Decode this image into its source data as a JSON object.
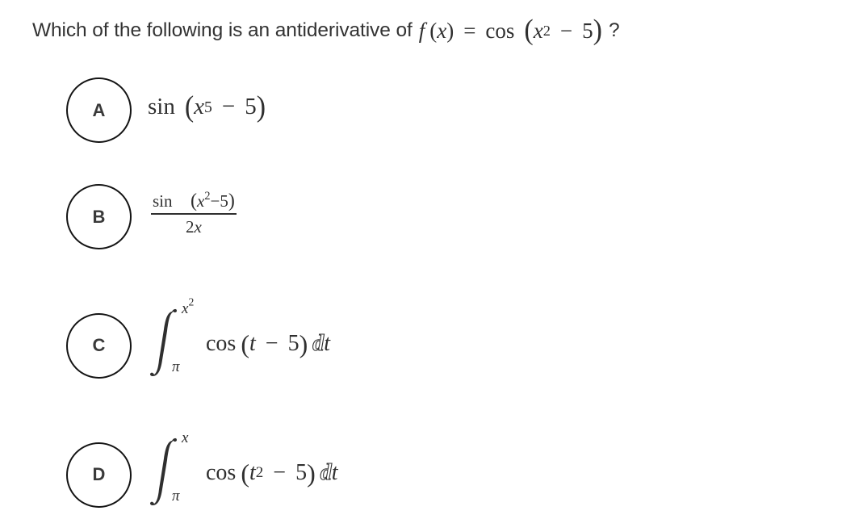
{
  "question": {
    "prefix": "Which of the following is an antiderivative of",
    "function_name": "f",
    "variable": "x",
    "equals": "=",
    "trig": "cos",
    "inner_var": "x",
    "inner_exp": "2",
    "minus": "−",
    "constant": "5",
    "open_paren": "(",
    "close_paren": ")",
    "suffix": "?"
  },
  "options": [
    {
      "label": "A",
      "latex": "\\sin\\left(x^5 - 5\\right)",
      "trig": "sin",
      "var": "x",
      "exp": "5",
      "minus": "−",
      "constant": "5",
      "open_paren": "(",
      "close_paren": ")"
    },
    {
      "label": "B",
      "latex": "\\frac{\\sin\\left(x^2-5\\right)}{2x}",
      "trig": "sin",
      "var": "x",
      "exp": "2",
      "minus": "−",
      "constant": "5",
      "open_paren": "(",
      "close_paren": ")",
      "den_coef": "2",
      "den_var": "x"
    },
    {
      "label": "C",
      "latex": "\\int_{\\pi}^{x^2} \\cos\\left(t-5\\right) dt",
      "lower": "π",
      "upper_var": "x",
      "upper_exp": "2",
      "trig": "cos",
      "var": "t",
      "minus": "−",
      "constant": "5",
      "open_paren": "(",
      "close_paren": ")",
      "d": "d",
      "dvar": "t"
    },
    {
      "label": "D",
      "latex": "\\int_{\\pi}^{x} \\cos\\left(t^2-5\\right) dt",
      "lower": "π",
      "upper_var": "x",
      "trig": "cos",
      "var": "t",
      "exp": "2",
      "minus": "−",
      "constant": "5",
      "open_paren": "(",
      "close_paren": ")",
      "d": "d",
      "dvar": "t"
    }
  ],
  "colors": {
    "text": "#333333",
    "bubble_border": "#141414",
    "background": "#ffffff"
  }
}
